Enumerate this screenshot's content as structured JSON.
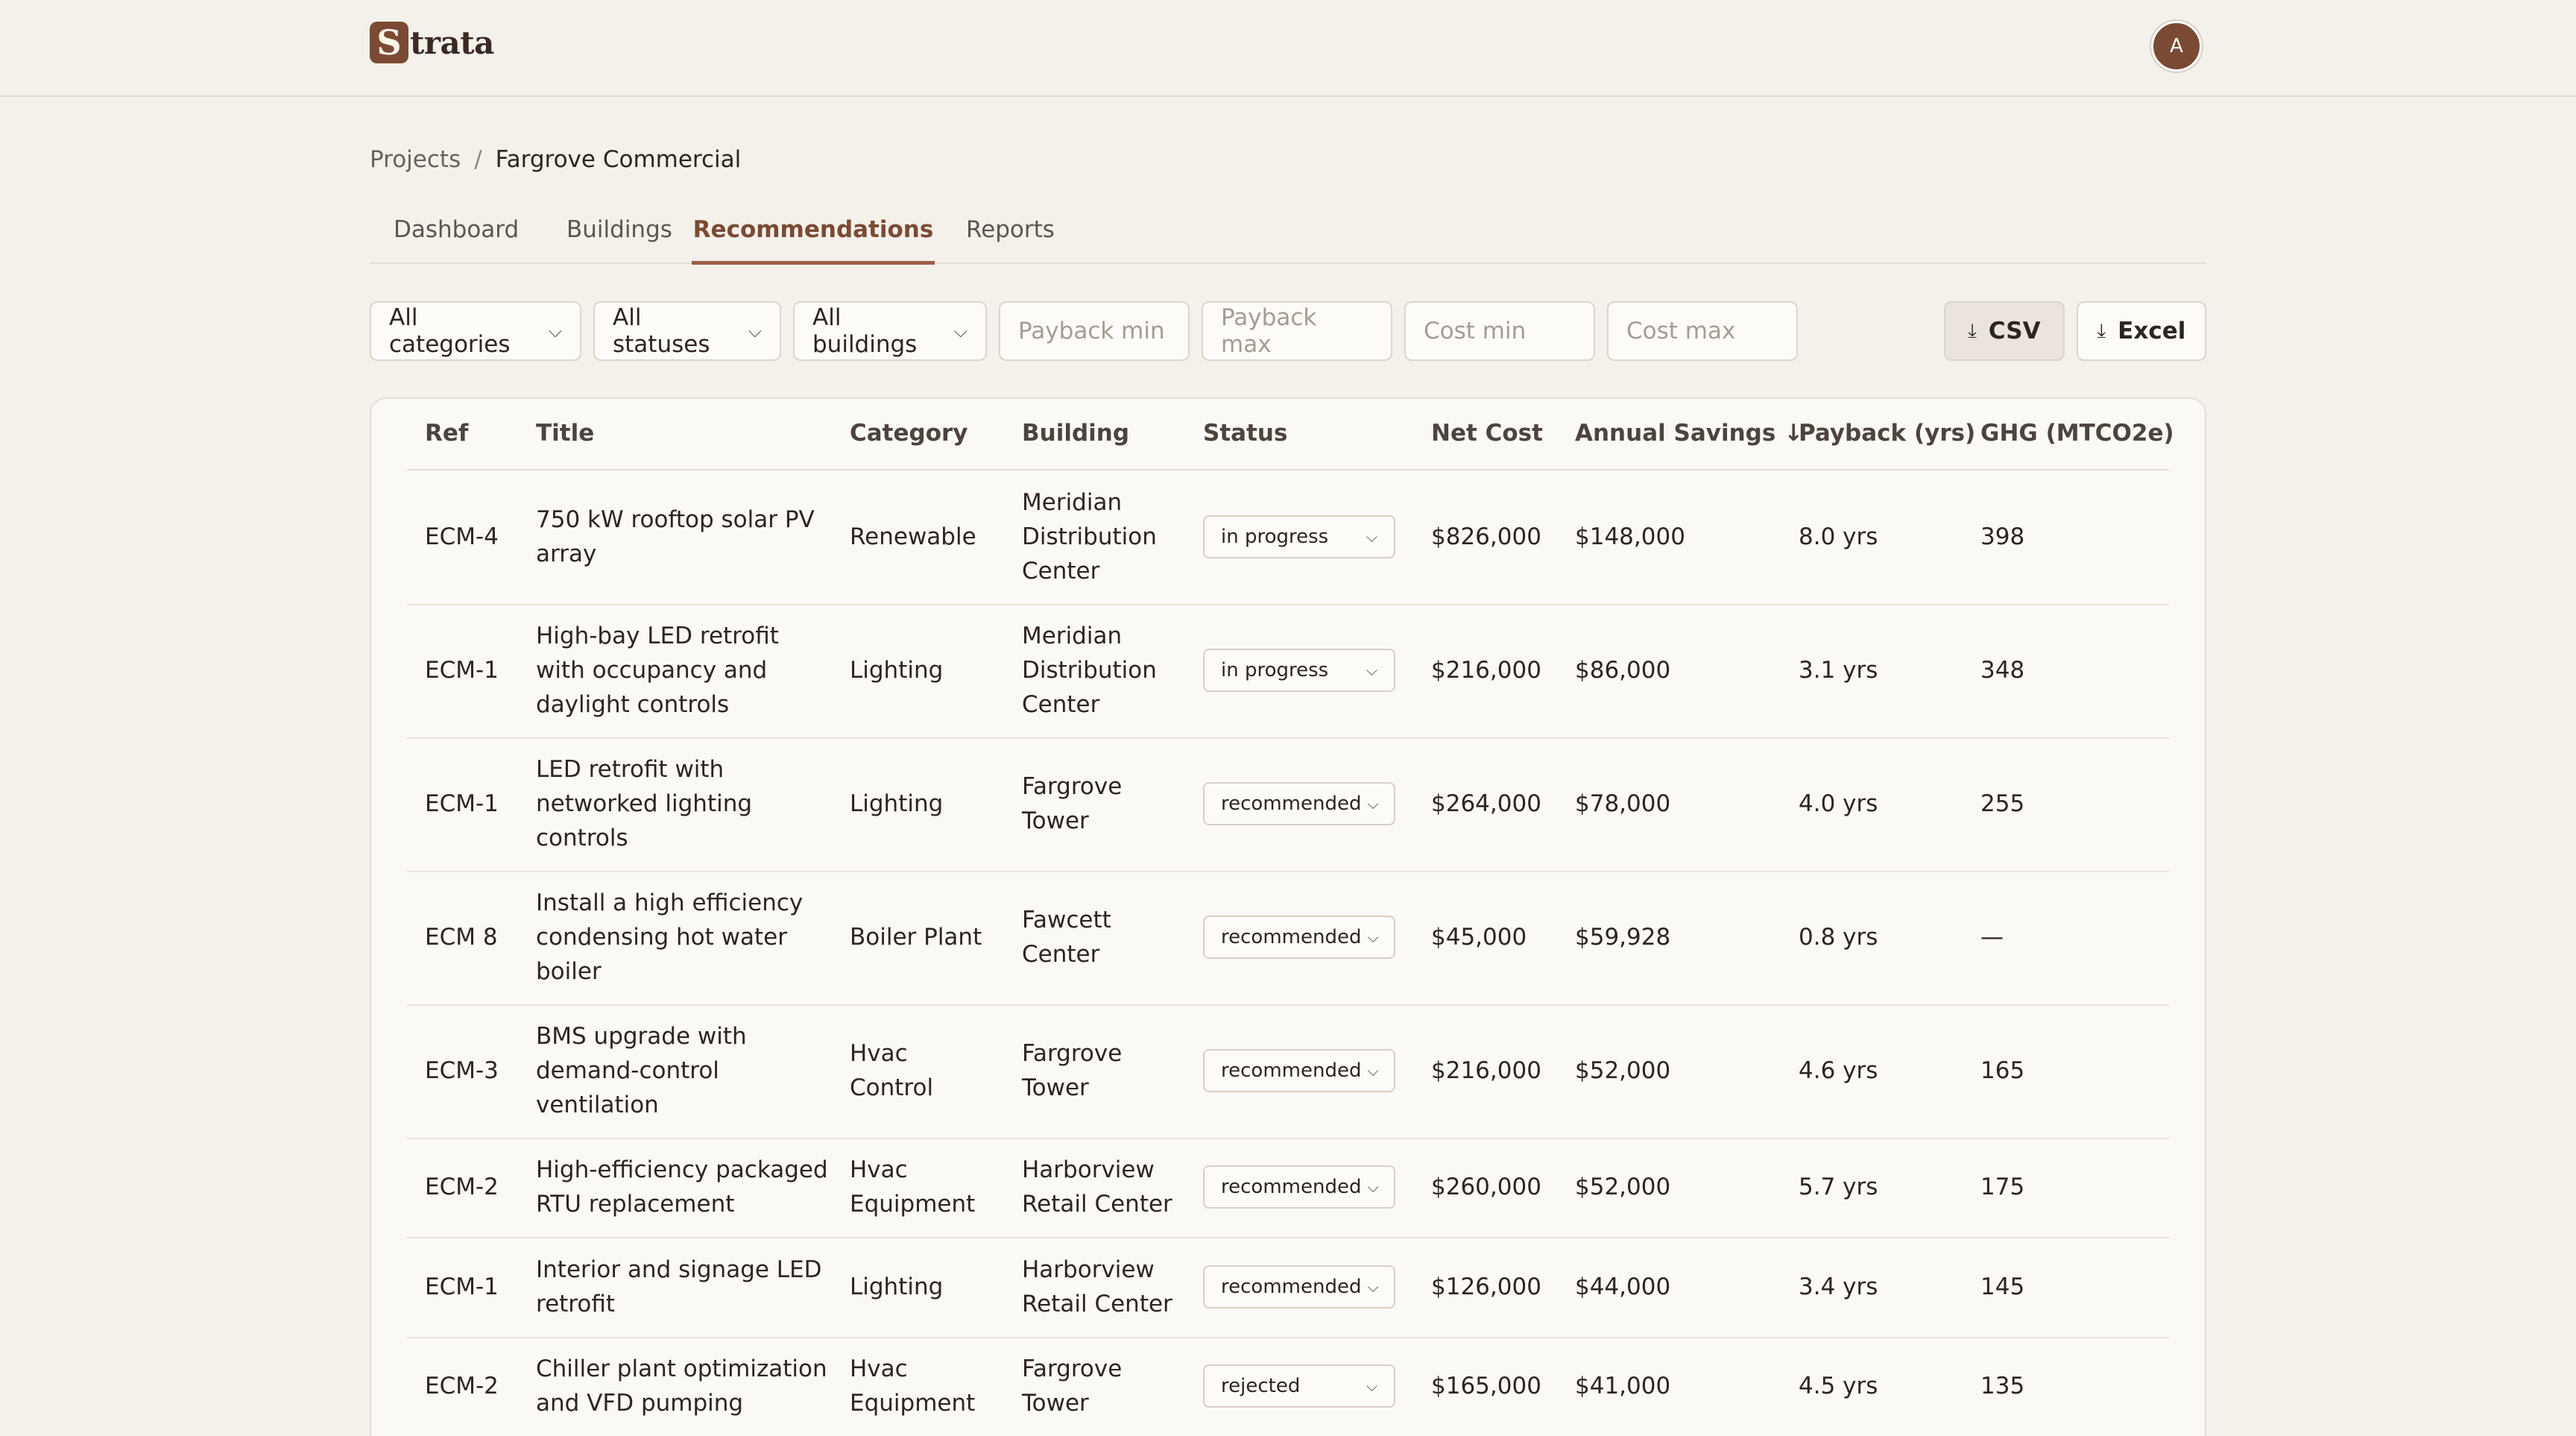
{
  "app": {
    "logo_letter": "S",
    "logo_text": "trata",
    "avatar_initial": "A"
  },
  "breadcrumb": {
    "parent": "Projects",
    "separator": "/",
    "current": "Fargrove Commercial"
  },
  "tabs": [
    {
      "label": "Dashboard"
    },
    {
      "label": "Buildings"
    },
    {
      "label": "Recommendations",
      "active": true
    },
    {
      "label": "Reports"
    }
  ],
  "filters": {
    "category": "All categories",
    "status": "All statuses",
    "building": "All buildings",
    "payback_min_placeholder": "Payback min",
    "payback_max_placeholder": "Payback max",
    "cost_min_placeholder": "Cost min",
    "cost_max_placeholder": "Cost max"
  },
  "export": {
    "csv": "CSV",
    "excel": "Excel"
  },
  "table": {
    "columns": {
      "ref": "Ref",
      "title": "Title",
      "category": "Category",
      "building": "Building",
      "status": "Status",
      "net_cost": "Net Cost",
      "annual_savings": "Annual Savings",
      "sort_indicator": "↓",
      "payback": "Payback (yrs)",
      "ghg": "GHG (MTCO2e)"
    },
    "rows": [
      {
        "ref": "ECM-4",
        "title": [
          "750 kW rooftop solar PV",
          "array"
        ],
        "category": [
          "Renewable"
        ],
        "building": [
          "Meridian",
          "Distribution",
          "Center"
        ],
        "status": "in progress",
        "net_cost": "$826,000",
        "annual_savings": "$148,000",
        "payback": "8.0 yrs",
        "ghg": "398"
      },
      {
        "ref": "ECM-1",
        "title": [
          "High-bay LED retrofit",
          "with occupancy and",
          "daylight controls"
        ],
        "category": [
          "Lighting"
        ],
        "building": [
          "Meridian",
          "Distribution",
          "Center"
        ],
        "status": "in progress",
        "net_cost": "$216,000",
        "annual_savings": "$86,000",
        "payback": "3.1 yrs",
        "ghg": "348"
      },
      {
        "ref": "ECM-1",
        "title": [
          "LED retrofit with",
          "networked lighting",
          "controls"
        ],
        "category": [
          "Lighting"
        ],
        "building": [
          "Fargrove",
          "Tower"
        ],
        "status": "recommended",
        "net_cost": "$264,000",
        "annual_savings": "$78,000",
        "payback": "4.0 yrs",
        "ghg": "255"
      },
      {
        "ref": "ECM 8",
        "title": [
          "Install a high efficiency",
          "condensing hot water",
          "boiler"
        ],
        "category": [
          "Boiler Plant"
        ],
        "building": [
          "Fawcett",
          "Center"
        ],
        "status": "recommended",
        "net_cost": "$45,000",
        "annual_savings": "$59,928",
        "payback": "0.8 yrs",
        "ghg": "—"
      },
      {
        "ref": "ECM-3",
        "title": [
          "BMS upgrade with",
          "demand-control",
          "ventilation"
        ],
        "category": [
          "Hvac",
          "Control"
        ],
        "building": [
          "Fargrove",
          "Tower"
        ],
        "status": "recommended",
        "net_cost": "$216,000",
        "annual_savings": "$52,000",
        "payback": "4.6 yrs",
        "ghg": "165"
      },
      {
        "ref": "ECM-2",
        "title": [
          "High-efficiency packaged",
          "RTU replacement"
        ],
        "category": [
          "Hvac",
          "Equipment"
        ],
        "building": [
          "Harborview",
          "Retail Center"
        ],
        "status": "recommended",
        "net_cost": "$260,000",
        "annual_savings": "$52,000",
        "payback": "5.7 yrs",
        "ghg": "175"
      },
      {
        "ref": "ECM-1",
        "title": [
          "Interior and signage LED",
          "retrofit"
        ],
        "category": [
          "Lighting"
        ],
        "building": [
          "Harborview",
          "Retail Center"
        ],
        "status": "recommended",
        "net_cost": "$126,000",
        "annual_savings": "$44,000",
        "payback": "3.4 yrs",
        "ghg": "145"
      },
      {
        "ref": "ECM-2",
        "title": [
          "Chiller plant optimization",
          "and VFD pumping"
        ],
        "category": [
          "Hvac",
          "Equipment"
        ],
        "building": [
          "Fargrove",
          "Tower"
        ],
        "status": "rejected",
        "net_cost": "$165,000",
        "annual_savings": "$41,000",
        "payback": "4.5 yrs",
        "ghg": "135"
      }
    ]
  },
  "colors": {
    "accent": "#7b4a34",
    "background": "#f4f0ea",
    "card": "#fbf9f6"
  }
}
